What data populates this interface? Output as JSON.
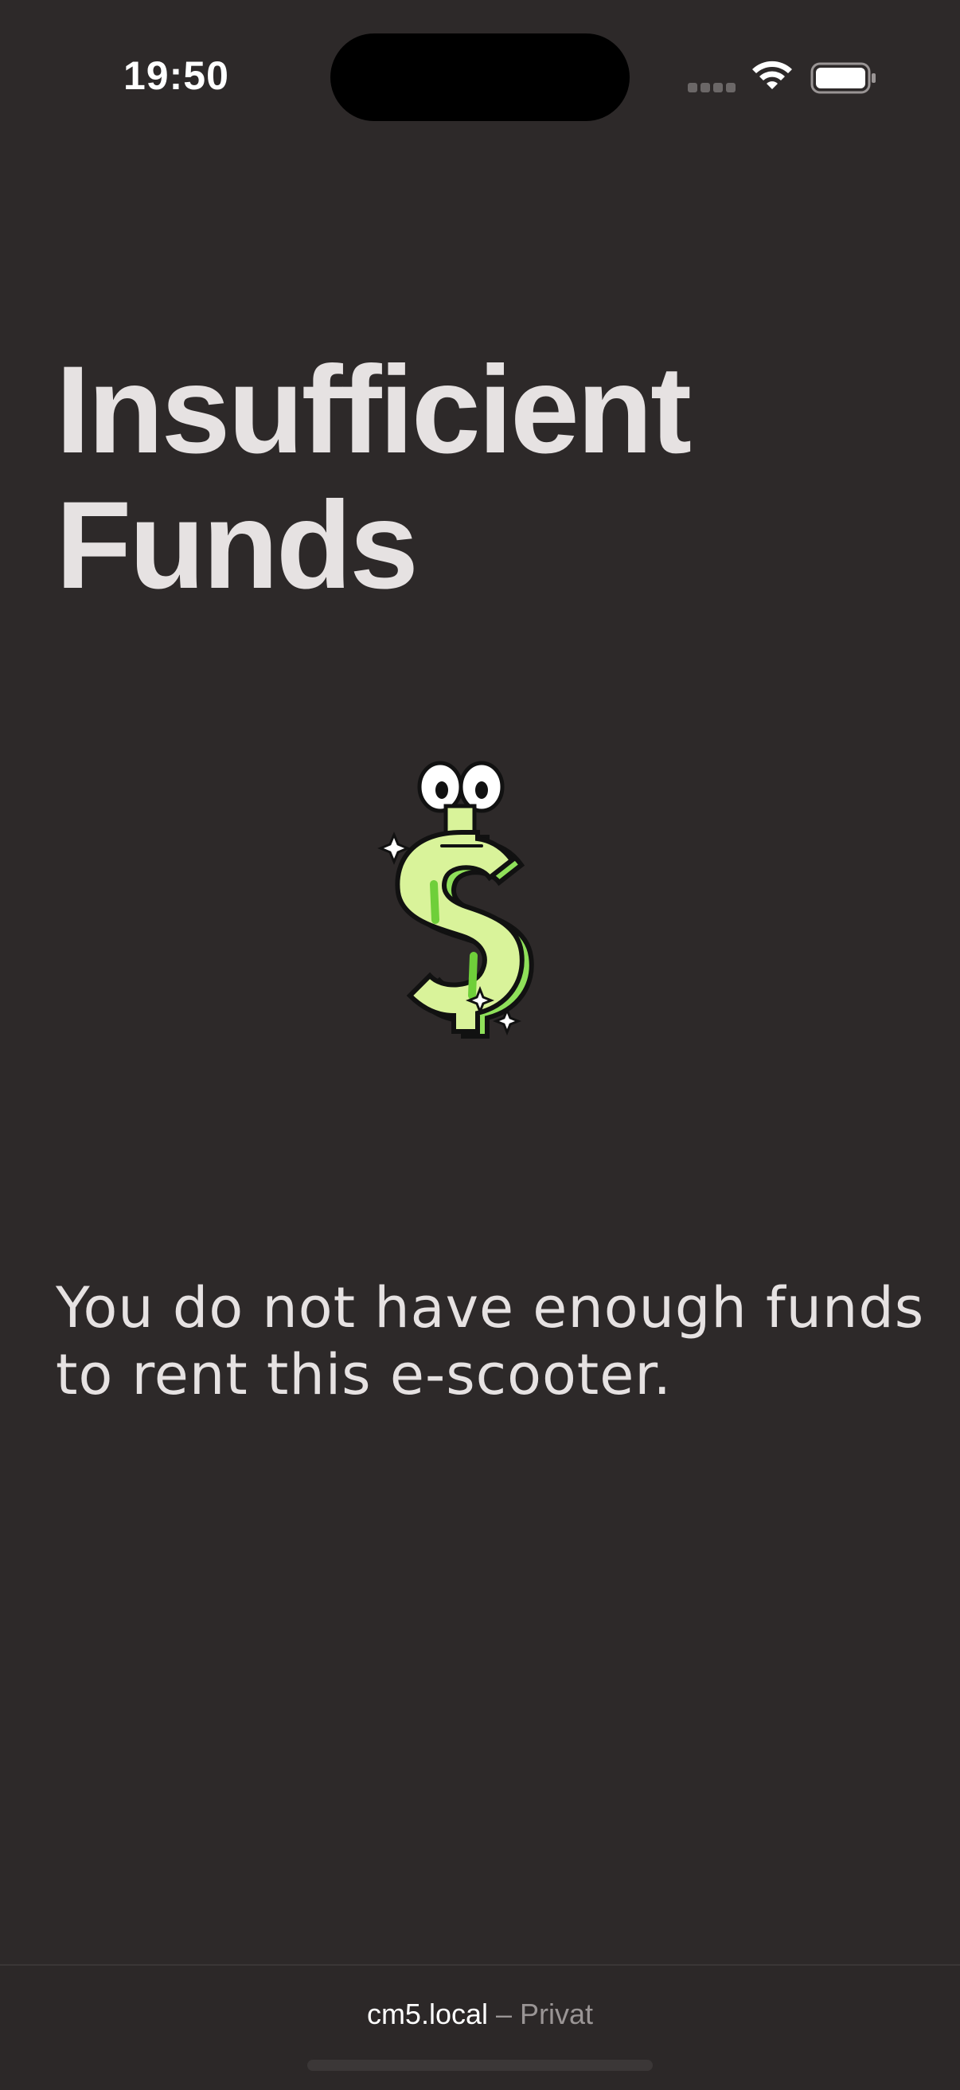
{
  "status_bar": {
    "time": "19:50",
    "icons": [
      "signal-icon",
      "wifi-icon",
      "battery-icon"
    ]
  },
  "main": {
    "title": "Insufficient Funds",
    "illustration": "dollar-sign-cartoon-icon",
    "message": "You do not have enough funds to rent this e-scooter."
  },
  "browser_bar": {
    "host": "cm5.local",
    "separator": " – ",
    "mode": "Privat"
  },
  "colors": {
    "background": "#2d2929",
    "text": "#e6e2e2",
    "dollar_fill": "#d9f39a",
    "dollar_shade": "#8fe05a"
  }
}
